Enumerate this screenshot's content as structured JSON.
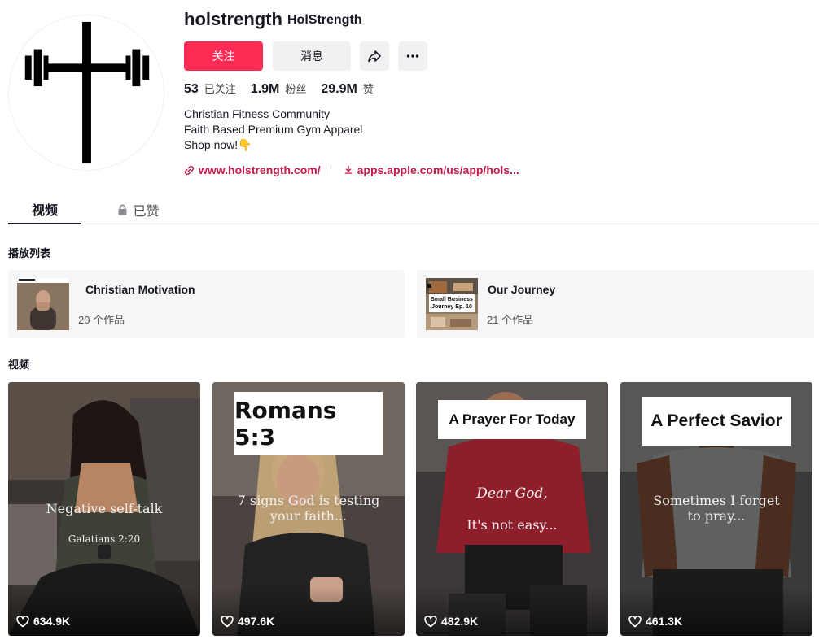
{
  "profile": {
    "username": "holstrength",
    "nickname": "HolStrength",
    "follow_label": "关注",
    "message_label": "消息",
    "stats": {
      "following_count": "53",
      "following_label": "已关注",
      "followers_count": "1.9M",
      "followers_label": "粉丝",
      "likes_count": "29.9M",
      "likes_label": "赞"
    },
    "bio": [
      "Christian Fitness Community",
      "Faith Based Premium Gym Apparel",
      "Shop now!👇"
    ],
    "links": [
      "www.holstrength.com/",
      "apps.apple.com/us/app/hols..."
    ]
  },
  "tabs": {
    "videos": "视频",
    "liked": "已赞"
  },
  "sections": {
    "playlists": "播放列表",
    "videos": "视频"
  },
  "playlists": [
    {
      "title": "Christian Motivation",
      "count": "20 个作品",
      "thumb_text": ""
    },
    {
      "title": "Our Journey",
      "count": "21 个作品",
      "thumb_text": "Small Business Journey Ep. 10"
    }
  ],
  "videos": [
    {
      "tag": "",
      "caption_line1": "Negative self-talk",
      "caption_line2": "Galatians 2:20",
      "likes": "634.9K"
    },
    {
      "tag": "Romans 5:3",
      "caption_line1": "7 signs God is testing",
      "caption_line2": "your faith...",
      "likes": "497.6K"
    },
    {
      "tag": "A Prayer For Today",
      "caption_line1": "Dear God,",
      "caption_line2": "It's not easy...",
      "likes": "482.9K"
    },
    {
      "tag": "A Perfect Savior",
      "caption_line1": "Sometimes I forget",
      "caption_line2": "to pray...",
      "likes": "461.3K"
    }
  ],
  "colors": {
    "accent": "#fe2c55",
    "link": "#c41a4a",
    "text": "#161823",
    "muted_bg": "#f1f1f2"
  },
  "icons": {
    "share": "share-arrow-icon",
    "more": "more-dots-icon",
    "link": "link-icon",
    "download": "download-icon",
    "lock": "lock-icon",
    "heart": "heart-outline-icon"
  }
}
